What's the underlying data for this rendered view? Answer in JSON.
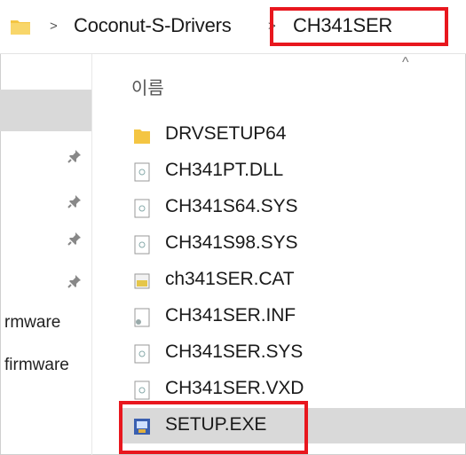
{
  "breadcrumb": {
    "separator": ">",
    "items": [
      "Coconut-S-Drivers",
      "CH341SER"
    ]
  },
  "nav": {
    "items": [
      "rmware",
      "firmware"
    ]
  },
  "file_list": {
    "column_name": "이름",
    "sort": "ascending",
    "files": [
      {
        "name": "DRVSETUP64",
        "icon": "folder-icon"
      },
      {
        "name": "CH341PT.DLL",
        "icon": "dll-file-icon"
      },
      {
        "name": "CH341S64.SYS",
        "icon": "system-file-icon"
      },
      {
        "name": "CH341S98.SYS",
        "icon": "system-file-icon"
      },
      {
        "name": "ch341SER.CAT",
        "icon": "catalog-file-icon"
      },
      {
        "name": "CH341SER.INF",
        "icon": "setup-info-file-icon"
      },
      {
        "name": "CH341SER.SYS",
        "icon": "system-file-icon"
      },
      {
        "name": "CH341SER.VXD",
        "icon": "system-file-icon"
      },
      {
        "name": "SETUP.EXE",
        "icon": "installer-exe-icon",
        "selected": true
      }
    ]
  },
  "colors": {
    "highlight_box": "#e8171e",
    "selection": "#d9d9d9",
    "folder": "#f4c542"
  }
}
